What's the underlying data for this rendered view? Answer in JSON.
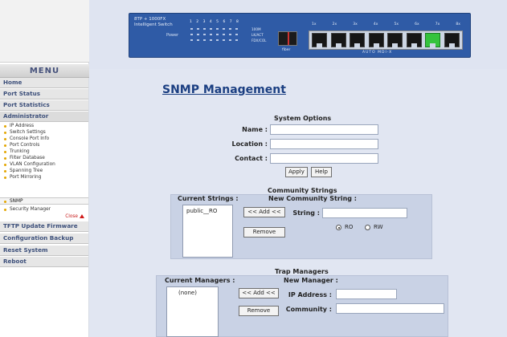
{
  "sidebar": {
    "menu_title": "MENU",
    "items": [
      {
        "label": "Home"
      },
      {
        "label": "Port Status"
      },
      {
        "label": "Port Statistics"
      },
      {
        "label": "Administrator"
      }
    ],
    "admin_subitems": [
      {
        "label": "IP Address"
      },
      {
        "label": "Switch Settings"
      },
      {
        "label": "Console Port Info"
      },
      {
        "label": "Port Controls"
      },
      {
        "label": "Trunking"
      },
      {
        "label": "Filter Database"
      },
      {
        "label": "VLAN Configuration"
      },
      {
        "label": "Spanning Tree"
      },
      {
        "label": "Port Mirroring"
      },
      {
        "label": "SNMP"
      },
      {
        "label": "Security Manager"
      }
    ],
    "close_label": "Close",
    "bottom_items": [
      {
        "label": "TFTP Update Firmware"
      },
      {
        "label": "Configuration Backup"
      },
      {
        "label": "Reset System"
      },
      {
        "label": "Reboot"
      }
    ]
  },
  "device": {
    "line1": "8TP + 1000FX",
    "line2": "Intelligent Switch",
    "power_label": "Power",
    "led_numbers": "1 2 3 4 5 6 7 8",
    "led_labels": [
      "100M",
      "LK/ACT",
      "FDX/COL"
    ],
    "fiber_label": "fiber",
    "port_labels": [
      "1x",
      "2x",
      "3x",
      "4x",
      "5x",
      "6x",
      "7x",
      "8x"
    ],
    "active_port_index": 6,
    "auto_mdi_label": "AUTO MDI-X"
  },
  "page": {
    "title": "SNMP Management"
  },
  "system_options": {
    "title": "System Options",
    "name_label": "Name :",
    "location_label": "Location :",
    "contact_label": "Contact :",
    "name_value": "",
    "location_value": "",
    "contact_value": "",
    "apply_label": "Apply",
    "help_label": "Help"
  },
  "community": {
    "title": "Community Strings",
    "current_label": "Current Strings :",
    "new_label": "New Community String :",
    "current_strings": [
      "public__RO"
    ],
    "add_label": "<< Add <<",
    "remove_label": "Remove",
    "string_label": "String :",
    "string_value": "",
    "ro_label": "RO",
    "rw_label": "RW",
    "selected": "RO"
  },
  "trap": {
    "title": "Trap Managers",
    "current_label": "Current Managers :",
    "new_label": "New Manager :",
    "current_managers": [
      "(none)"
    ],
    "add_label": "<< Add <<",
    "remove_label": "Remove",
    "ip_label": "IP Address :",
    "community_label": "Community :",
    "ip_value": "",
    "community_value": ""
  },
  "colors": {
    "title_blue": "#1b3f82",
    "panel": "#c9d2e5",
    "device_blue": "#2f5ba6",
    "active_port": "#35c33c"
  }
}
